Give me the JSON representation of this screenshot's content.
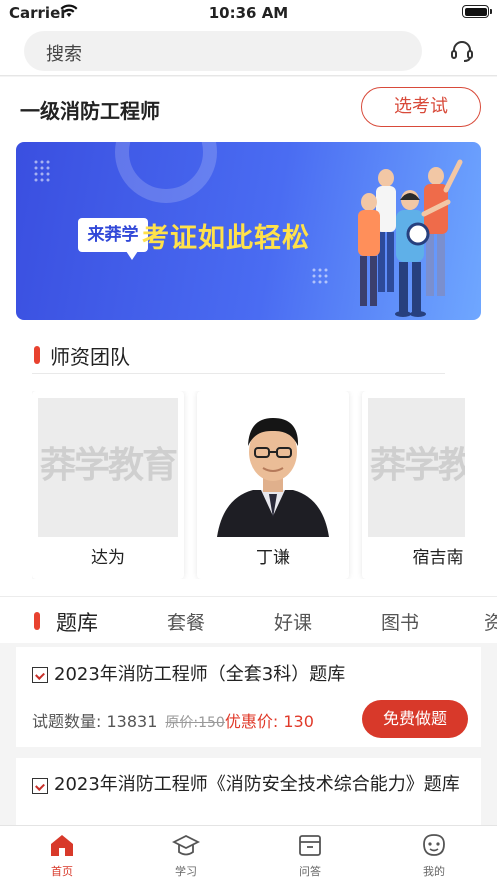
{
  "status_bar": {
    "carrier": "Carrier",
    "time": "10:36 AM"
  },
  "search": {
    "placeholder": "搜索",
    "support_icon": "headset-icon"
  },
  "exam": {
    "title": "一级消防工程师",
    "select_button": "选考试"
  },
  "banner": {
    "logo_text": "来莽学",
    "slogan": "考证如此轻松"
  },
  "teachers": {
    "heading": "师资团队",
    "watermark": "莽学教育",
    "items": [
      {
        "name": "达为",
        "photo": "placeholder"
      },
      {
        "name": "丁谦",
        "photo": "portrait"
      },
      {
        "name": "宿吉南",
        "photo": "placeholder"
      }
    ]
  },
  "category_tabs": [
    {
      "label": "题库",
      "active": true
    },
    {
      "label": "套餐",
      "active": false
    },
    {
      "label": "好课",
      "active": false
    },
    {
      "label": "图书",
      "active": false
    },
    {
      "label": "资",
      "active": false
    }
  ],
  "courses": [
    {
      "title": "2023年消防工程师（全套3科）题库",
      "count_label": "试题数量: ",
      "count": "13831",
      "original_price": "原价:150",
      "sale_label": "优惠价: ",
      "sale_price": "130",
      "button": "免费做题"
    },
    {
      "title": "2023年消防工程师《消防安全技术综合能力》题库"
    }
  ],
  "tabbar": [
    {
      "label": "首页",
      "icon": "home-icon",
      "active": true
    },
    {
      "label": "学习",
      "icon": "graduation-cap-icon",
      "active": false
    },
    {
      "label": "问答",
      "icon": "archive-box-icon",
      "active": false
    },
    {
      "label": "我的",
      "icon": "smiley-face-icon",
      "active": false
    }
  ],
  "colors": {
    "accent": "#d8392a",
    "banner_blue": "#4a6cf2",
    "slogan_yellow": "#ffe14a"
  }
}
